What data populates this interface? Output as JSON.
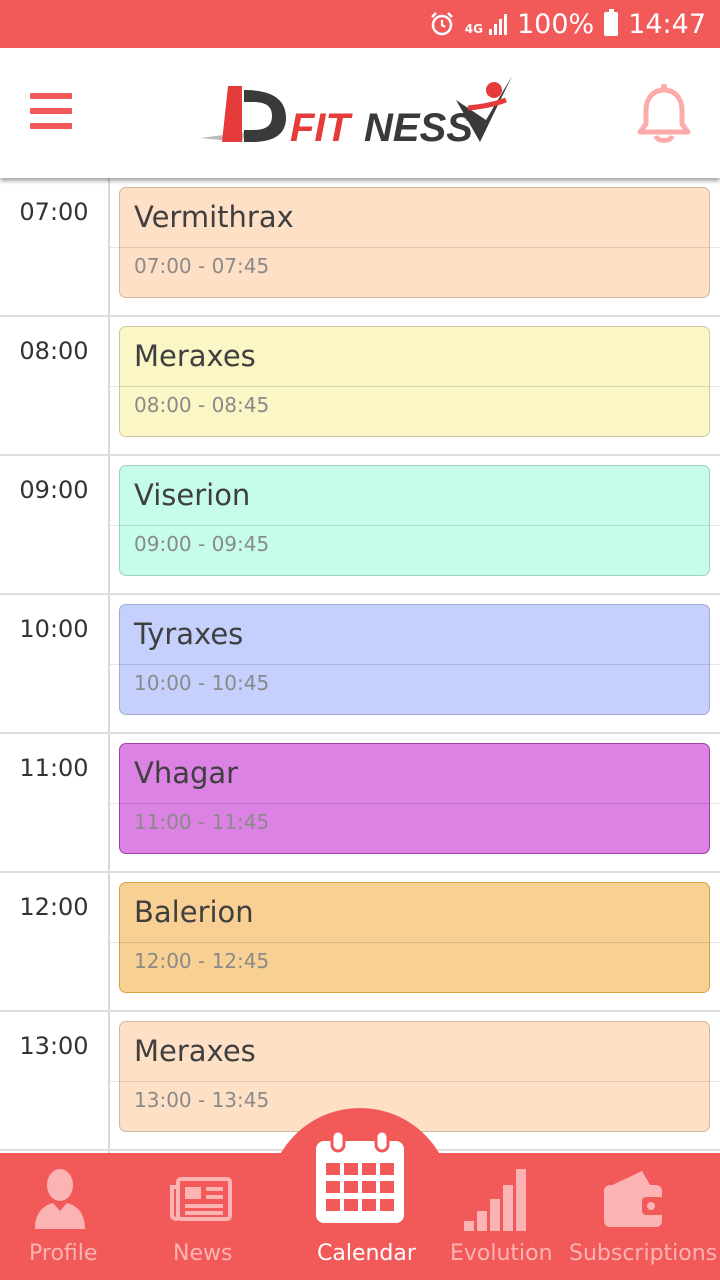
{
  "status_bar": {
    "network": "4G",
    "battery": "100%",
    "time": "14:47",
    "icons": [
      "alarm-icon",
      "signal-icon",
      "battery-icon"
    ]
  },
  "app_bar": {
    "logo_text": "IDFITNESS",
    "menu_icon": "hamburger-menu-icon",
    "notification_icon": "bell-icon"
  },
  "schedule": {
    "slots": [
      {
        "time": "07:00",
        "title": "Vermithrax",
        "range": "07:00 - 07:45",
        "color": "#fde0c5"
      },
      {
        "time": "08:00",
        "title": "Meraxes",
        "range": "08:00 - 08:45",
        "color": "#fbf6c5"
      },
      {
        "time": "09:00",
        "title": "Viserion",
        "range": "09:00 - 09:45",
        "color": "#c5fde9"
      },
      {
        "time": "10:00",
        "title": "Tyraxes",
        "range": "10:00 - 10:45",
        "color": "#c5d0fd"
      },
      {
        "time": "11:00",
        "title": "Vhagar",
        "range": "11:00 - 11:45",
        "color": "#dc82e4"
      },
      {
        "time": "12:00",
        "title": "Balerion",
        "range": "12:00 - 12:45",
        "color": "#f9d093"
      },
      {
        "time": "13:00",
        "title": "Meraxes",
        "range": "13:00 - 13:45",
        "color": "#fde0c5"
      }
    ]
  },
  "bottom_nav": {
    "active": "Calendar",
    "items": [
      {
        "label": "Profile",
        "icon": "person-icon"
      },
      {
        "label": "News",
        "icon": "newspaper-icon"
      },
      {
        "label": "Calendar",
        "icon": "calendar-icon"
      },
      {
        "label": "Evolution",
        "icon": "bar-chart-icon"
      },
      {
        "label": "Subscriptions",
        "icon": "wallet-icon"
      }
    ]
  },
  "colors": {
    "brand": "#f25a5a",
    "inactive_nav": "#fbb3b3"
  }
}
